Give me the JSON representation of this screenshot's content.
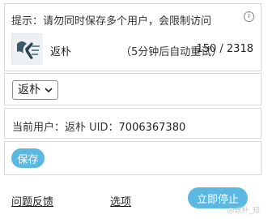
{
  "notice": {
    "text": "提示：请勿同时保存多个用户，会限制访问",
    "info_icon": "info-circle-icon"
  },
  "user_row": {
    "avatar_icon": "user-avatar-logo",
    "name": "返朴",
    "retry_text": "（5分钟后自动重试）",
    "progress_text": "150 / 2318",
    "progress": {
      "current": 150,
      "total": 2318
    }
  },
  "select": {
    "selected": "返朴"
  },
  "current_user": {
    "label": "当前用户：",
    "name": "返朴",
    "uid_label": " UID：",
    "uid": "7006367380"
  },
  "save": {
    "label": "保存"
  },
  "footer": {
    "feedback_label": "问题反馈",
    "options_label": "选项",
    "stop_label": "立即停止",
    "watermark": "@返朴_知"
  },
  "colors": {
    "accent": "#5bb8e0",
    "border": "#d9d9d9"
  }
}
